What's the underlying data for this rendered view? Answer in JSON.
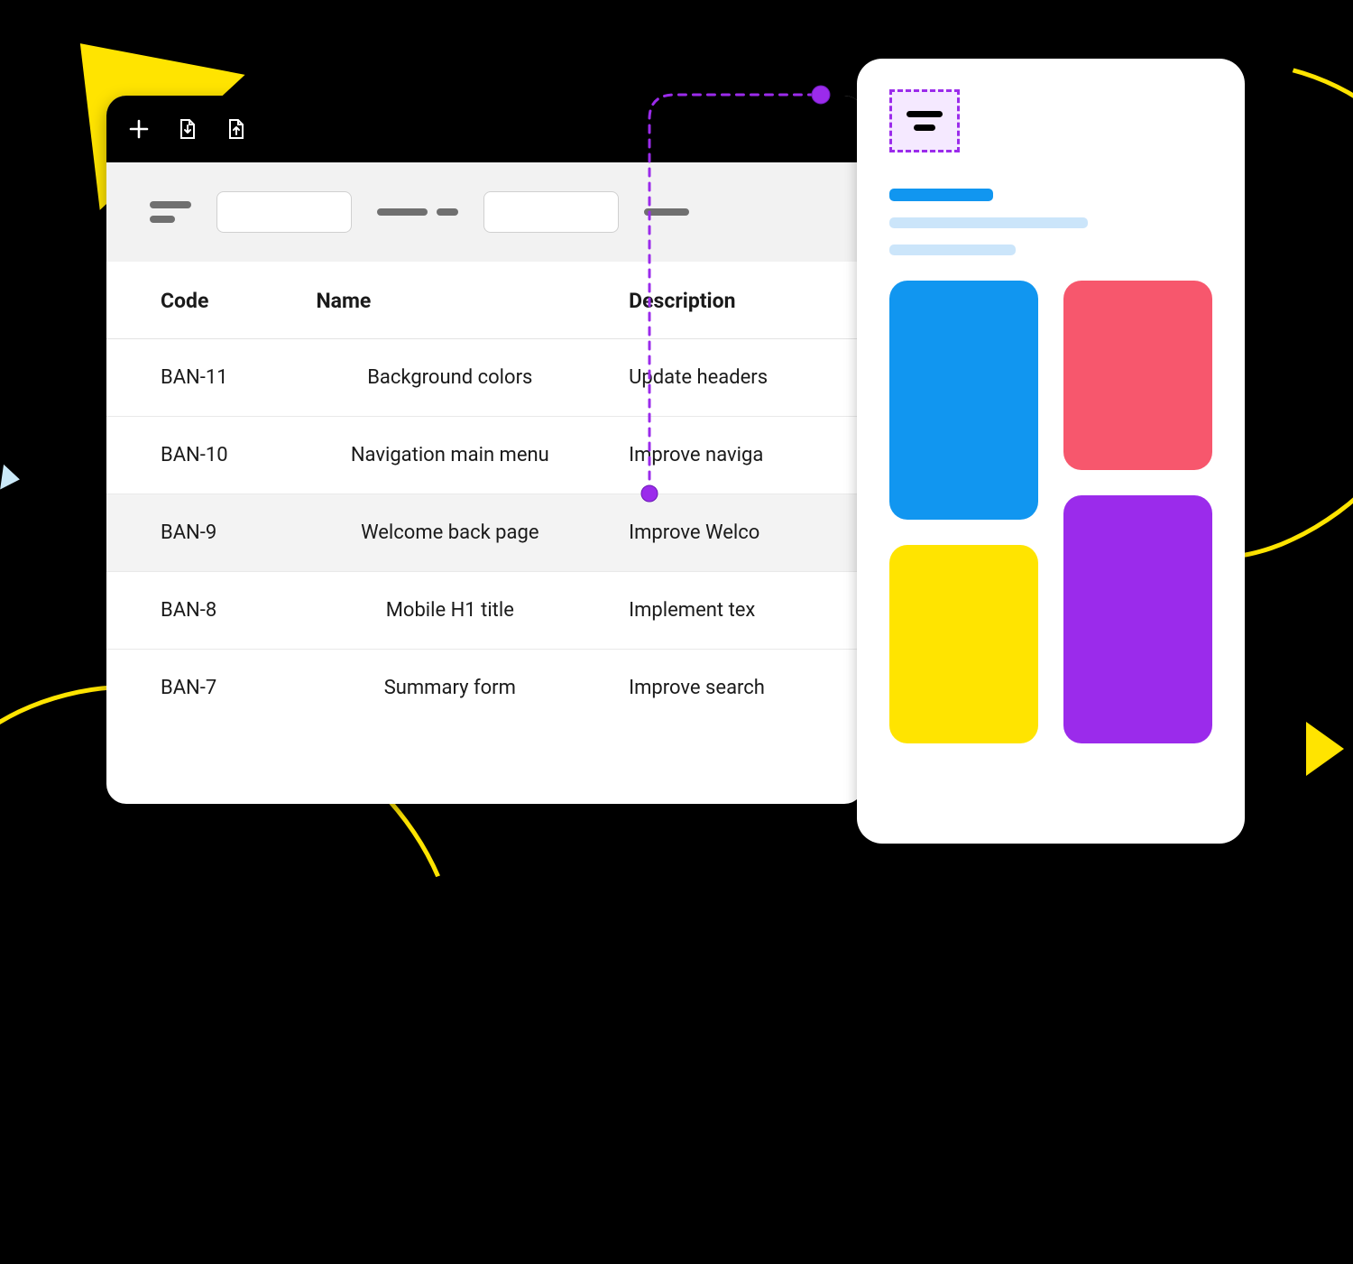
{
  "colors": {
    "accent_yellow": "#FFE400",
    "accent_purple": "#9B2BEB",
    "sky_blue": "#1196F0",
    "pink": "#F7576D"
  },
  "list_window": {
    "toolbar_icons": [
      "plus",
      "import",
      "export"
    ],
    "columns": {
      "code": "Code",
      "name": "Name",
      "description": "Description"
    },
    "rows": [
      {
        "code": "BAN-11",
        "name": "Background colors",
        "description": "Update headers"
      },
      {
        "code": "BAN-10",
        "name": "Navigation main menu",
        "description": "Improve naviga"
      },
      {
        "code": "BAN-9",
        "name": "Welcome back page",
        "description": "Improve Welco"
      },
      {
        "code": "BAN-8",
        "name": "Mobile H1 title",
        "description": "Implement  tex"
      },
      {
        "code": "BAN-7",
        "name": "Summary form",
        "description": "Improve search"
      }
    ],
    "highlighted_row_index": 2
  },
  "detail_card": {
    "tiles": [
      "blue",
      "pink",
      "yellow",
      "purple"
    ]
  }
}
